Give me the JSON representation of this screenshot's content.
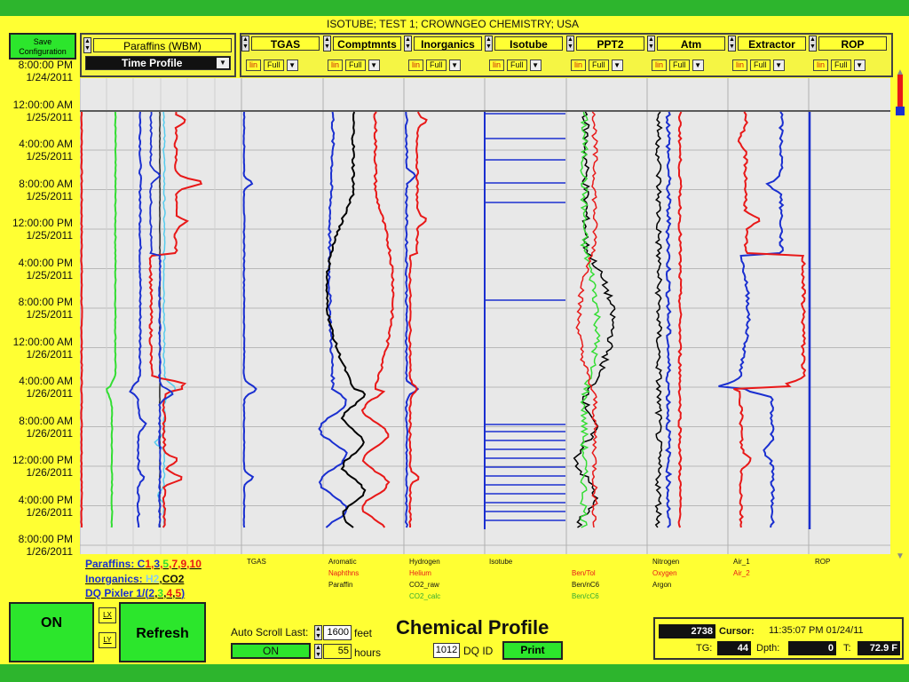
{
  "header": {
    "title": "ISOTUBE;  TEST 1;  CROWNGEO CHEMISTRY;  USA",
    "save_config": "Save Configuration",
    "paraffins_select": "Paraffins (WBM)",
    "time_profile": "Time Profile",
    "tracks": [
      "TGAS",
      "Comptmnts",
      "Inorganics",
      "Isotube",
      "PPT2",
      "Atm",
      "Extractor",
      "ROP"
    ],
    "scale_lin": "lin",
    "scale_full": "Full"
  },
  "time_axis": [
    "8:00:00 PM|1/24/2011",
    "12:00:00 AM|1/25/2011",
    "4:00:00 AM|1/25/2011",
    "8:00:00 AM|1/25/2011",
    "12:00:00 PM|1/25/2011",
    "4:00:00 PM|1/25/2011",
    "8:00:00 PM|1/25/2011",
    "12:00:00 AM|1/26/2011",
    "4:00:00 AM|1/26/2011",
    "8:00:00 AM|1/26/2011",
    "12:00:00 PM|1/26/2011",
    "4:00:00 PM|1/26/2011",
    "8:00:00 PM|1/26/2011"
  ],
  "legend": {
    "paraffins_prefix": "Paraffins: C",
    "paraffins_nums": [
      "1",
      "3",
      "5",
      "7",
      "9",
      "10"
    ],
    "inorganics_prefix": "Inorganics: ",
    "inorganics_h2": "H2",
    "inorganics_co2": ",CO2",
    "dq_prefix": "DQ Pixler 1/(",
    "dq_nums": [
      "2",
      "3",
      "4",
      "5"
    ],
    "dq_suffix": ")",
    "tgas": "TGAS",
    "compt": [
      "Aromatic",
      "Naphthns",
      "Paraffin"
    ],
    "inorg": [
      "Hydrogen",
      "Helium",
      "CO2_raw",
      "CO2_calc"
    ],
    "isotube": "Isotube",
    "ppt2": [
      "Ben/Tol",
      "Ben/nC6",
      "Ben/cC6"
    ],
    "atm": [
      "Nitrogen",
      "Oxygen",
      "Argon"
    ],
    "extractor": [
      "Air_1",
      "Air_2"
    ],
    "rop": "ROP"
  },
  "bottom": {
    "on_label": "ON",
    "lx": "LX",
    "ly": "LY",
    "refresh": "Refresh",
    "auto_scroll": "Auto Scroll Last:",
    "feet_value": "1600",
    "feet": "feet",
    "hours_value": "55",
    "hours": "hours",
    "on_small": "ON",
    "chem_title": "Chemical Profile",
    "dq_value": "1012",
    "dq_id": "DQ ID",
    "print": "Print",
    "count": "2738",
    "cursor_label": "Cursor:",
    "cursor_time": "11:35:07 PM 01/24/11",
    "tg_label": "TG:",
    "tg_value": "44",
    "depth_label": "Dpth:",
    "depth_value": "0",
    "t_label": "T:",
    "t_value": "72.9 F"
  },
  "colors": {
    "bg_green": "#2db52d",
    "panel_yellow": "#ffff33",
    "plot_bg": "#e8e8e8",
    "blue": "#1a2fd0",
    "red": "#e81818",
    "green": "#33dd33",
    "cyan": "#55ccee",
    "black": "#000000"
  }
}
